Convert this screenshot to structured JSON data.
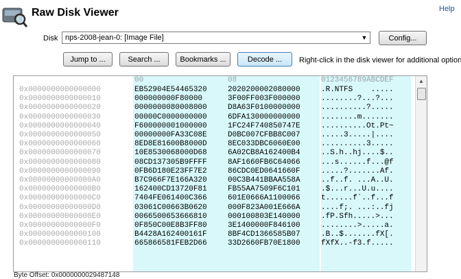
{
  "app": {
    "title": "Raw Disk Viewer",
    "help_label": "Help"
  },
  "disk": {
    "label": "Disk",
    "selected": "nps-2008-jean-0: [Image File]"
  },
  "buttons": {
    "config": "Config...",
    "jump": "Jump to ...",
    "search": "Search ...",
    "bookmarks": "Bookmarks ...",
    "decode": "Decode ..."
  },
  "hint": "Right-click in the disk viewer for additional options",
  "viewer": {
    "header": {
      "col0": "00",
      "col8": "08",
      "ascii": "0123456789ABCDEF"
    },
    "rows": [
      {
        "offset": "0x0000000000000000",
        "hex1": "EB52904E54465320",
        "hex2": "2020200002080000",
        "ascii": ".R.NTFS    ....."
      },
      {
        "offset": "0x0000000000000010",
        "hex1": "000000000F80000",
        "hex2": "3F00FF003F000000",
        "ascii": "........?...?..."
      },
      {
        "offset": "0x0000000000000020",
        "hex1": "0000000080008000",
        "hex2": "D8A63F0100000000",
        "ascii": "..........?....."
      },
      {
        "offset": "0x0000000000000030",
        "hex1": "00000C0000000000",
        "hex2": "6DFA130000000000",
        "ascii": "........m......."
      },
      {
        "offset": "0x0000000000000040",
        "hex1": "F600000001000000",
        "hex2": "1FC24F740850747E",
        "ascii": "..........Ot.Pt~"
      },
      {
        "offset": "0x0000000000000050",
        "hex1": "00000000FA33C08E",
        "hex2": "D0BC007CFBB8C007",
        "ascii": ".....3.....|...."
      },
      {
        "offset": "0x0000000000000060",
        "hex1": "8ED8E81600B8000D",
        "hex2": "8EC033DBC6060E00",
        "ascii": "..........3....."
      },
      {
        "offset": "0x0000000000000070",
        "hex1": "10E8530068000D68",
        "hex2": "6A02CB8A162400B4",
        "ascii": "..S.h..hj....$.."
      },
      {
        "offset": "0x0000000000000080",
        "hex1": "08CD137305B9FFFF",
        "hex2": "8AF1660FB6C64066",
        "ascii": "...s......f...@f"
      },
      {
        "offset": "0x0000000000000090",
        "hex1": "0FB6D180E23FF7E2",
        "hex2": "86CDC0ED0641660F",
        "ascii": ".....?.......Af."
      },
      {
        "offset": "0x00000000000000A0",
        "hex1": "B7C966F7E166A320",
        "hex2": "00C3B441BBAA558A",
        "ascii": "..f..f. ...A..U."
      },
      {
        "offset": "0x00000000000000B0",
        "hex1": "162400CD13720F81",
        "hex2": "FB55AA7509F6C101",
        "ascii": ".$...r...U.u...."
      },
      {
        "offset": "0x00000000000000C0",
        "hex1": "7404FE061400C366",
        "hex2": "601E0666A1100066",
        "ascii": "t......f`..f...f"
      },
      {
        "offset": "0x00000000000000D0",
        "hex1": "03061C00663B0620",
        "hex2": "000F823A001E666A",
        "ascii": "....f;. ...:..fj"
      },
      {
        "offset": "0x00000000000000E0",
        "hex1": "0066500653666810",
        "hex2": "000100803E140000",
        "ascii": ".fP.Sfh.....>..."
      },
      {
        "offset": "0x00000000000000F0",
        "hex1": "0F850C00E8B3FF80",
        "hex2": "3E1400000F846100",
        "ascii": "........>.....a."
      },
      {
        "offset": "0x0000000000000100",
        "hex1": "B4428A162400161F",
        "hex2": "8BF4CD1366585B07",
        "ascii": ".B..$.......fX[."
      },
      {
        "offset": "0x0000000000000110",
        "hex1": "665866581FEB2D66",
        "hex2": "33D2660FB70E1800",
        "ascii": "fXfX..-f3.f....."
      }
    ]
  },
  "status": {
    "byte_offset": "Byte Offset: 0x0000000029487148"
  },
  "colors": {
    "hex_bg": "#d8f8fa",
    "offset_text": "#a8a8a8",
    "link": "#1a4fa3"
  }
}
